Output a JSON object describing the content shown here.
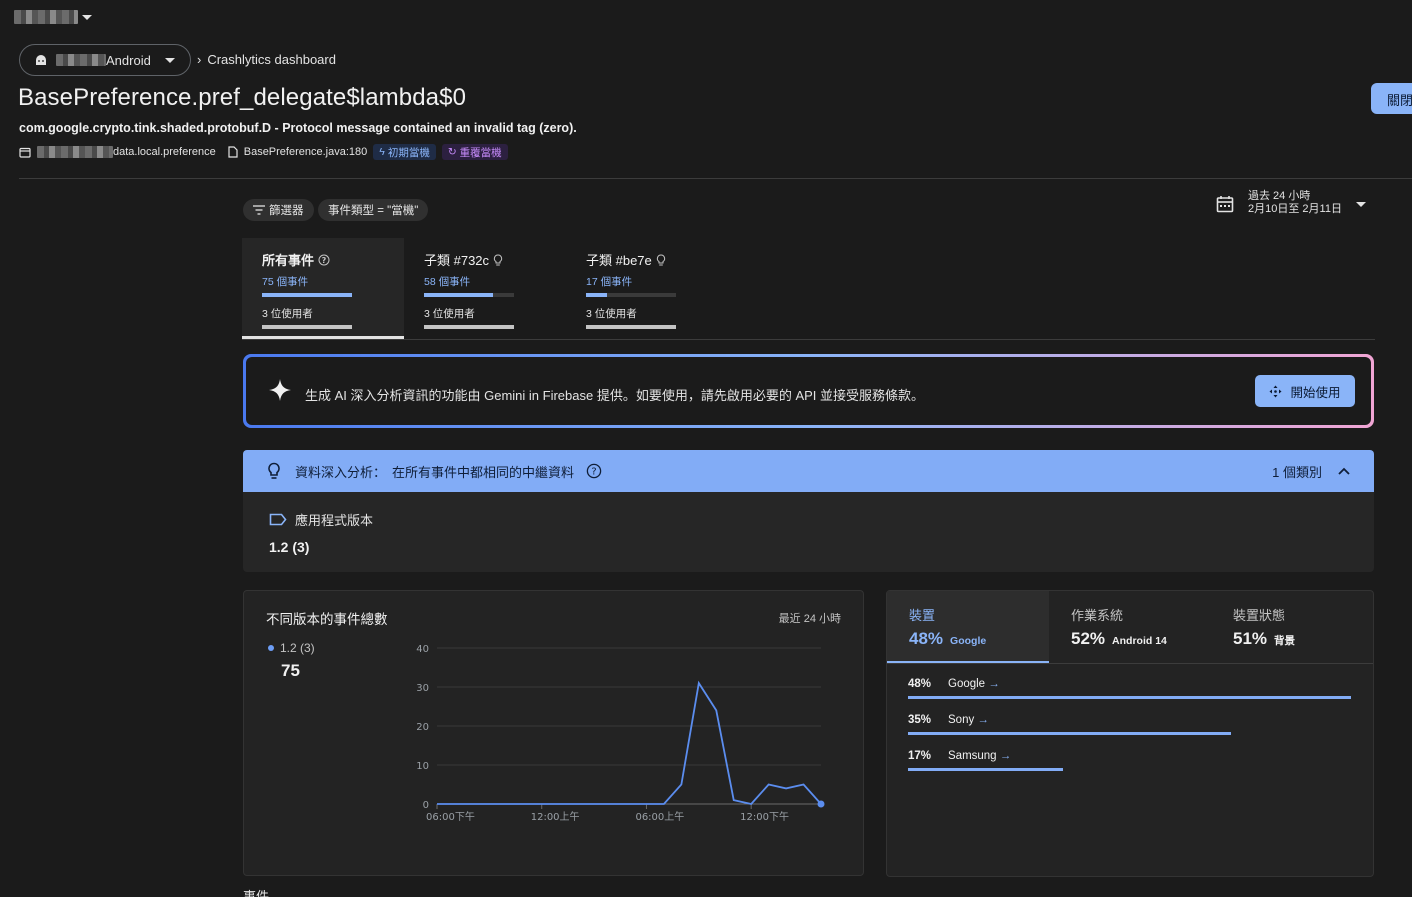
{
  "header": {
    "app_chip_label": "Android",
    "breadcrumb_current": "Crashlytics dashboard",
    "close_button": "關閉"
  },
  "issue": {
    "title": "BasePreference.pref_delegate$lambda$0",
    "subtitle": "com.google.crypto.tink.shaded.protobuf.D - Protocol message contained an invalid tag (zero).",
    "package_suffix": "data.local.preference",
    "file": "BasePreference.java:180",
    "badge_early": "初期當機",
    "badge_regressed": "重覆當機"
  },
  "filters": {
    "filter_chip": "篩選器",
    "event_type_chip": "事件類型 = \"當機\"",
    "date_range_line1": "過去 24 小時",
    "date_range_line2": "2月10日至 2月11日"
  },
  "event_tabs": [
    {
      "title": "所有事件",
      "events": "75 個事件",
      "events_fraction": 1.0,
      "users": "3 位使用者",
      "users_fraction": 1.0
    },
    {
      "title": "子類 #732c",
      "events": "58 個事件",
      "events_fraction": 0.77,
      "users": "3 位使用者",
      "users_fraction": 1.0
    },
    {
      "title": "子類 #be7e",
      "events": "17 個事件",
      "events_fraction": 0.23,
      "users": "3 位使用者",
      "users_fraction": 1.0
    }
  ],
  "gemini": {
    "text": "生成 AI 深入分析資訊的功能由 Gemini in Firebase 提供。如要使用，請先啟用必要的 API 並接受服務條款。",
    "button": "開始使用"
  },
  "insights": {
    "label": "資料深入分析：",
    "description": "在所有事件中都相同的中繼資料",
    "count": "1 個類別",
    "item_label": "應用程式版本",
    "item_value": "1.2 (3)"
  },
  "chart_card": {
    "title": "不同版本的事件總數",
    "range": "最近 24 小時",
    "legend_name": "1.2 (3)",
    "legend_value": "75"
  },
  "chart_data": {
    "type": "line",
    "title": "不同版本的事件總數",
    "x_tick_labels": [
      "06:00下午",
      "12:00上午",
      "06:00上午",
      "12:00下午"
    ],
    "x_tick_index": [
      0,
      6,
      12,
      18
    ],
    "y_ticks": [
      0,
      10,
      20,
      30,
      40
    ],
    "ylim": [
      0,
      40
    ],
    "series": [
      {
        "name": "1.2 (3)",
        "color": "#5b8def",
        "values": [
          0,
          0,
          0,
          0,
          0,
          0,
          0,
          0,
          0,
          0,
          0,
          0,
          0,
          0,
          5,
          31,
          24,
          1,
          0,
          5,
          4,
          5,
          0
        ]
      }
    ],
    "grid": true
  },
  "device_card": {
    "tabs": [
      {
        "header": "裝置",
        "pct": "48%",
        "name": "Google"
      },
      {
        "header": "作業系統",
        "pct": "52%",
        "name": "Android 14"
      },
      {
        "header": "裝置狀態",
        "pct": "51%",
        "name": "背景"
      }
    ],
    "rows": [
      {
        "pct": "48%",
        "name": "Google",
        "fraction": 1.0
      },
      {
        "pct": "35%",
        "name": "Sony",
        "fraction": 0.73
      },
      {
        "pct": "17%",
        "name": "Samsung",
        "fraction": 0.35
      }
    ]
  },
  "bottom": {
    "events_label": "事件"
  },
  "colors": {
    "accent": "#8ab4f8",
    "background": "#1b1b1b",
    "card": "#232323"
  }
}
